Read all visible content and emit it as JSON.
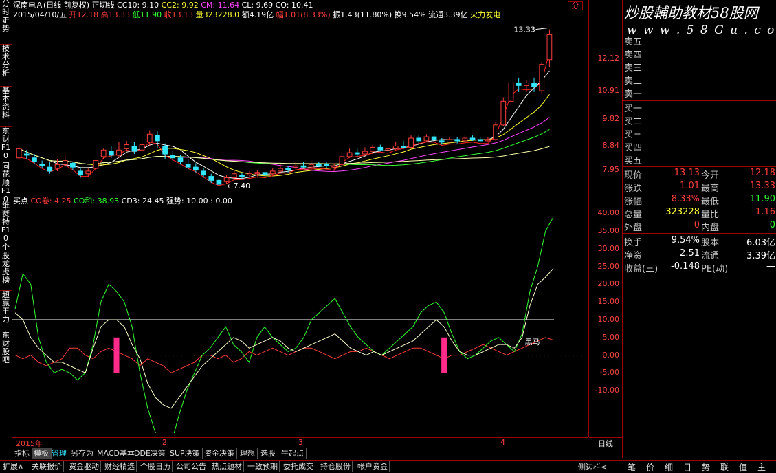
{
  "left_tabs": [
    "分时走势",
    "技术分析",
    "基本资料",
    "东财F10",
    "同花顺F10",
    "维赛特F10",
    "个股龙虎榜",
    "超赢王力",
    "东财股吧"
  ],
  "header": {
    "stock": "深南电Ａ(日线 前复权)",
    "indicator": "正切线",
    "cc10": "CC10: 9.10",
    "cc2": "CC2: 9.92",
    "cm": "CM: 11.64",
    "cl": "CL: 9.69",
    "co": "CO: 10.41",
    "date": "2015/04/10/五",
    "open": "开12.18",
    "high": "高13.33",
    "low": "低11.90",
    "close": "收13.13",
    "vol": "量323228.0",
    "amount": "额4.19亿",
    "change": "幅1.01(8.33%)",
    "amp": "振1.43(11.80%)",
    "turnover": "换9.54%",
    "float": "流通3.39亿",
    "sector": "火力发电"
  },
  "sub_header": {
    "name": "买点",
    "co_drop": "CO卷: 4.25",
    "co_sum": "CO和: 38.93",
    "cd3": "CD3: 24.45",
    "strong": "强势: 10.00 : 0.00"
  },
  "watermark": {
    "line1": "炒股輔助教材58股网",
    "line2": "w w w . 5 8 G u . c o m"
  },
  "top_right_label": "分",
  "annotations": {
    "high_mark": "13.33",
    "low_mark": "7.40",
    "buy_label": "黑马"
  },
  "price_axis": [
    "12.12",
    "10.91",
    "9.82",
    "8.84",
    "7.95"
  ],
  "osc_axis": [
    "40.00",
    "35.00",
    "30.00",
    "25.00",
    "20.00",
    "15.00",
    "10.00",
    "5.00",
    "0.00",
    "-5.00",
    "-10.00"
  ],
  "x_axis": [
    "2015年",
    "2",
    "3",
    "4"
  ],
  "period": "日线",
  "order_book": {
    "sell": [
      "卖五",
      "卖四",
      "卖三",
      "卖二",
      "卖一"
    ],
    "buy": [
      "买一",
      "买二",
      "买三",
      "买四",
      "买五"
    ]
  },
  "quote_rows": [
    {
      "l1": "现价",
      "v1": "13.13",
      "c1": "#ff3d3d",
      "l2": "今开",
      "v2": "12.18",
      "c2": "#ff3d3d"
    },
    {
      "l1": "涨跌",
      "v1": "1.01",
      "c1": "#ff3d3d",
      "l2": "最高",
      "v2": "13.33",
      "c2": "#ff3d3d"
    },
    {
      "l1": "涨幅",
      "v1": "8.33%",
      "c1": "#ff3d3d",
      "l2": "最低",
      "v2": "11.90",
      "c2": "#33ff33"
    },
    {
      "l1": "总量",
      "v1": "323228",
      "c1": "#ffff33",
      "l2": "量比",
      "v2": "1.16",
      "c2": "#ff3d3d"
    },
    {
      "l1": "外盘",
      "v1": "0",
      "c1": "#ff3d3d",
      "l2": "内盘",
      "v2": "0",
      "c2": "#33ff33"
    },
    {
      "l1": "换手",
      "v1": "9.54%",
      "c1": "#ffffff",
      "l2": "股本",
      "v2": "6.03亿",
      "c2": "#ffffff"
    },
    {
      "l1": "净资",
      "v1": "2.51",
      "c1": "#ffffff",
      "l2": "流通",
      "v2": "3.39亿",
      "c2": "#ffffff"
    },
    {
      "l1": "收益(三)",
      "v1": "-0.148",
      "c1": "#ffffff",
      "l2": "PE(动)",
      "v2": "—",
      "c2": "#ffffff"
    }
  ],
  "tabs_row1": [
    "指标",
    "模板",
    "管理",
    "另存为",
    "MACD基本",
    "DDE决策",
    "SUP决策",
    "资金决策",
    "理想",
    "选股",
    "牛起点"
  ],
  "tabs_row2": [
    "扩展∧",
    "关联报价",
    "资金驱动",
    "财经精选",
    "个股日历",
    "公司公告",
    "热点题材",
    "一致预期",
    "委托成交",
    "持仓股份",
    "帐户资金"
  ],
  "right_bottom": {
    "side": "侧边栏<",
    "tabs": [
      "笔",
      "价",
      "细",
      "日",
      "势",
      "联",
      "值",
      "主"
    ]
  },
  "chart_data": [
    {
      "type": "candlestick",
      "title": "深南电Ａ(日线 前复权)",
      "ylim": [
        7.4,
        13.4
      ],
      "candles": [
        [
          8.45,
          8.8,
          8.9,
          8.35
        ],
        [
          8.6,
          8.55,
          8.75,
          8.4
        ],
        [
          8.45,
          8.3,
          8.6,
          8.2
        ],
        [
          8.2,
          8.15,
          8.35,
          8.05
        ],
        [
          8.1,
          7.95,
          8.3,
          7.85
        ],
        [
          8.05,
          8.2,
          8.4,
          7.95
        ],
        [
          8.2,
          8.35,
          8.55,
          8.1
        ],
        [
          8.25,
          8.1,
          8.3,
          8.0
        ],
        [
          7.95,
          7.8,
          8.1,
          7.7
        ],
        [
          7.85,
          7.95,
          8.05,
          7.75
        ],
        [
          8.05,
          8.35,
          8.45,
          7.95
        ],
        [
          8.5,
          8.75,
          8.8,
          8.4
        ],
        [
          8.7,
          8.55,
          8.9,
          8.45
        ],
        [
          8.55,
          8.75,
          9.05,
          8.45
        ],
        [
          8.8,
          8.95,
          9.1,
          8.7
        ],
        [
          8.9,
          8.7,
          9.05,
          8.6
        ],
        [
          8.75,
          8.95,
          9.2,
          8.65
        ],
        [
          9.05,
          9.35,
          9.5,
          8.9
        ],
        [
          9.3,
          9.1,
          9.45,
          8.8
        ],
        [
          8.9,
          8.6,
          9.0,
          8.4
        ],
        [
          8.55,
          8.45,
          8.7,
          8.35
        ],
        [
          8.45,
          8.3,
          8.55,
          8.2
        ],
        [
          8.2,
          8.1,
          8.4,
          8.0
        ],
        [
          8.1,
          8.0,
          8.25,
          7.9
        ],
        [
          7.95,
          7.8,
          8.05,
          7.7
        ],
        [
          7.75,
          7.6,
          7.85,
          7.5
        ],
        [
          7.6,
          7.45,
          7.7,
          7.4
        ],
        [
          7.55,
          7.7,
          7.8,
          7.45
        ],
        [
          7.7,
          7.85,
          7.95,
          7.6
        ],
        [
          7.8,
          7.75,
          7.9,
          7.65
        ],
        [
          7.8,
          7.85,
          7.95,
          7.7
        ],
        [
          7.85,
          7.9,
          8.0,
          7.75
        ],
        [
          7.9,
          7.8,
          8.0,
          7.7
        ],
        [
          7.85,
          7.95,
          8.05,
          7.8
        ],
        [
          7.95,
          8.05,
          8.2,
          7.85
        ],
        [
          8.05,
          8.0,
          8.15,
          7.9
        ],
        [
          8.1,
          8.15,
          8.3,
          8.0
        ],
        [
          8.15,
          8.1,
          8.3,
          8.05
        ],
        [
          8.1,
          8.2,
          8.35,
          8.0
        ],
        [
          8.2,
          8.15,
          8.3,
          8.1
        ],
        [
          8.2,
          8.15,
          8.3,
          8.05
        ],
        [
          8.1,
          8.15,
          8.25,
          8.0
        ],
        [
          8.2,
          8.5,
          8.7,
          8.15
        ],
        [
          8.5,
          8.65,
          8.8,
          8.45
        ],
        [
          8.65,
          8.6,
          8.8,
          8.5
        ],
        [
          8.6,
          8.7,
          8.85,
          8.55
        ],
        [
          8.7,
          8.85,
          8.95,
          8.6
        ],
        [
          8.85,
          8.75,
          8.95,
          8.7
        ],
        [
          8.75,
          8.8,
          8.9,
          8.65
        ],
        [
          8.8,
          8.9,
          9.05,
          8.75
        ],
        [
          8.9,
          8.85,
          9.1,
          8.8
        ],
        [
          8.85,
          9.2,
          9.3,
          8.8
        ],
        [
          9.2,
          9.1,
          9.3,
          9.0
        ],
        [
          9.1,
          9.25,
          9.35,
          9.05
        ],
        [
          9.25,
          9.15,
          9.35,
          9.05
        ],
        [
          9.1,
          9.05,
          9.2,
          8.95
        ],
        [
          9.05,
          9.15,
          9.25,
          9.0
        ],
        [
          9.15,
          9.1,
          9.25,
          9.0
        ],
        [
          9.1,
          9.2,
          9.3,
          9.05
        ],
        [
          9.2,
          9.15,
          9.3,
          9.1
        ],
        [
          9.15,
          9.1,
          9.25,
          9.05
        ],
        [
          9.1,
          9.15,
          9.25,
          9.05
        ],
        [
          9.15,
          9.7,
          9.8,
          9.1
        ],
        [
          9.7,
          10.6,
          10.75,
          9.65
        ],
        [
          10.6,
          11.3,
          11.45,
          10.5
        ],
        [
          11.3,
          11.2,
          11.5,
          10.95
        ],
        [
          11.2,
          11.3,
          11.4,
          10.95
        ],
        [
          11.3,
          11.15,
          11.5,
          10.95
        ],
        [
          11.0,
          12.0,
          12.1,
          10.9
        ],
        [
          12.18,
          13.13,
          13.33,
          11.9
        ]
      ]
    },
    {
      "type": "line",
      "title": "买点",
      "ylim": [
        -22,
        42
      ],
      "series": [
        {
          "name": "CO卷",
          "color": "#ff3d3d",
          "values": [
            0,
            -1,
            0,
            -2,
            -3,
            -2,
            -1,
            2,
            2,
            0,
            -1,
            1,
            2,
            1,
            0,
            -1,
            -3,
            -1,
            -2,
            -3,
            -5,
            -4,
            -3,
            -2,
            0,
            0,
            -1,
            0,
            -2,
            -1,
            1,
            0,
            1,
            2,
            1,
            0,
            1,
            2,
            2,
            1,
            0,
            -1,
            0,
            1,
            1,
            2,
            1,
            0,
            -1,
            0,
            1,
            2,
            2,
            1,
            0,
            -1,
            0,
            0,
            1,
            2,
            3,
            2,
            1,
            0,
            1,
            2,
            3,
            4,
            5,
            4.25
          ]
        },
        {
          "name": "CO和",
          "color": "#33ff33",
          "values": [
            13,
            23,
            20,
            5,
            -2,
            -5,
            -4,
            -5,
            -7,
            -5,
            3,
            15,
            20,
            18,
            15,
            8,
            -5,
            -15,
            -22,
            -24,
            -25,
            -17,
            -10,
            -5,
            0,
            2,
            5,
            8,
            3,
            1,
            -2,
            5,
            8,
            5,
            3,
            1,
            2,
            5,
            10,
            12,
            14,
            16,
            12,
            8,
            5,
            3,
            1,
            0,
            2,
            4,
            6,
            8,
            12,
            14,
            15,
            12,
            6,
            1,
            -1,
            0,
            2,
            4,
            5,
            3,
            1,
            6,
            18,
            25,
            35,
            38.93
          ]
        },
        {
          "name": "CD3",
          "color": "#ffffcc",
          "values": [
            12,
            10,
            5,
            2,
            0,
            -2,
            -2,
            -3,
            -4,
            -5,
            2,
            8,
            10,
            10,
            8,
            3,
            -1,
            -8,
            -12,
            -14,
            -15,
            -12,
            -9,
            -6,
            -3,
            -1,
            1,
            3,
            5,
            4,
            2,
            3,
            4,
            5,
            4,
            2,
            1,
            2,
            3,
            4,
            5,
            6,
            4,
            2,
            1,
            0,
            1,
            0,
            1,
            2,
            3,
            4,
            6,
            8,
            10,
            8,
            4,
            1,
            0,
            0,
            1,
            2,
            3,
            3,
            2,
            5,
            14,
            20,
            22,
            24.45
          ]
        },
        {
          "name": "强势",
          "color": "#ffffff",
          "values": [
            10,
            10
          ]
        }
      ],
      "signals": [
        {
          "index": 13,
          "type": "buy"
        },
        {
          "index": 55,
          "type": "buy"
        }
      ]
    }
  ]
}
